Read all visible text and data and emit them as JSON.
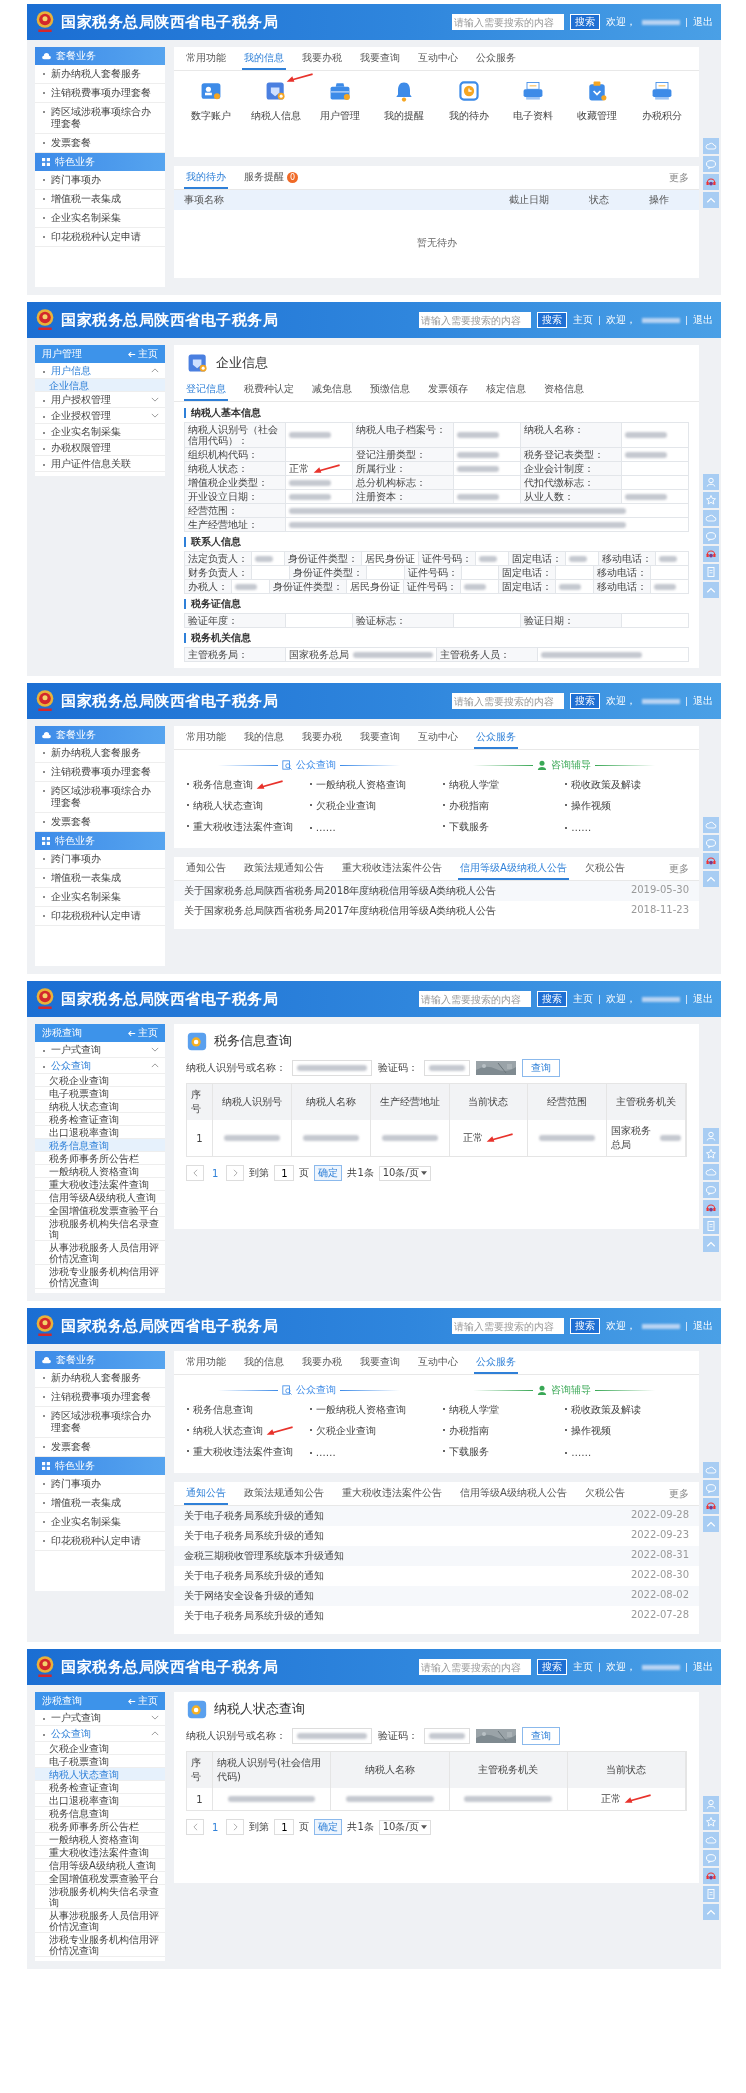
{
  "shots": [
    {
      "header": {
        "title": "国家税务总局陕西省电子税务局",
        "search_placeholder": "请输入需要搜索的内容",
        "search_button": "搜索",
        "welcome": "欢迎，",
        "logout": "退出"
      },
      "sidebar": {
        "kind": "groups",
        "groups": [
          {
            "title": "套餐业务",
            "items": [
              "新办纳税人套餐服务",
              "注销税费事项办理套餐",
              "跨区域涉税事项综合办理套餐",
              "发票套餐"
            ]
          },
          {
            "title": "特色业务",
            "items": [
              "跨门事项办",
              "增值税一表集成",
              "企业实名制采集",
              "印花税税种认定申请"
            ]
          }
        ]
      },
      "main": {
        "kind": "home",
        "tabs": [
          {
            "label": "常用功能",
            "selected": false
          },
          {
            "label": "我的信息",
            "selected": true
          },
          {
            "label": "我要办税",
            "selected": false
          },
          {
            "label": "我要查询",
            "selected": false
          },
          {
            "label": "互动中心",
            "selected": false
          },
          {
            "label": "公众服务",
            "selected": false
          }
        ],
        "apps": [
          {
            "label": "数字账户"
          },
          {
            "label": "纳税人信息",
            "annotated": true
          },
          {
            "label": "用户管理"
          },
          {
            "label": "我的提醒"
          },
          {
            "label": "我的待办"
          },
          {
            "label": "电子资料"
          },
          {
            "label": "收藏管理"
          },
          {
            "label": "办税积分"
          }
        ],
        "todo": {
          "tabs": [
            {
              "label": "我的待办",
              "selected": true
            },
            {
              "label": "服务提醒",
              "selected": false,
              "badge": "0"
            }
          ],
          "more": "更多",
          "columns": [
            "事项名称",
            "截止日期",
            "状态",
            "操作"
          ],
          "empty": "暂无待办"
        }
      },
      "side_tools": [
        {
          "kind": "cloud"
        },
        {
          "kind": "chat"
        },
        {
          "kind": "service"
        },
        {
          "kind": "top"
        }
      ]
    },
    {
      "header": {
        "title": "国家税务总局陕西省电子税务局",
        "search_placeholder": "请输入需要搜索的内容",
        "search_button": "搜索",
        "home_link": "主页",
        "welcome": "欢迎，",
        "logout": "退出"
      },
      "sidebar": {
        "kind": "nav",
        "title": "用户管理",
        "home": "主页",
        "items": [
          {
            "label": "用户信息",
            "selected": true,
            "expanded": true,
            "children": [
              {
                "label": "企业信息",
                "selected": true
              }
            ]
          },
          {
            "label": "用户授权管理",
            "selected": false,
            "expanded": false
          },
          {
            "label": "企业授权管理",
            "selected": false,
            "expanded": false
          },
          {
            "label": "企业实名制采集",
            "selected": false
          },
          {
            "label": "办税权限管理",
            "selected": false
          },
          {
            "label": "用户证件信息关联",
            "selected": false
          }
        ]
      },
      "main": {
        "kind": "company",
        "title": "企业信息",
        "tabs": [
          {
            "label": "登记信息",
            "selected": true
          },
          {
            "label": "税费种认定",
            "selected": false
          },
          {
            "label": "减免信息",
            "selected": false
          },
          {
            "label": "预缴信息",
            "selected": false
          },
          {
            "label": "发票领存",
            "selected": false
          },
          {
            "label": "核定信息",
            "selected": false
          },
          {
            "label": "资格信息",
            "selected": false
          }
        ],
        "sections": [
          {
            "title": "纳税人基本信息",
            "rows": [
              [
                {
                  "label": "纳税人识别号（社会信用代码）：",
                  "blurred": true
                },
                {
                  "label": "纳税人电子档案号：",
                  "blurred": true
                },
                {
                  "label": "纳税人名称：",
                  "blurred": true
                }
              ],
              [
                {
                  "label": "组织机构代码：",
                  "blurred": false
                },
                {
                  "label": "登记注册类型：",
                  "blurred": true
                },
                {
                  "label": "税务登记表类型：",
                  "blurred": true
                }
              ],
              [
                {
                  "label": "纳税人状态：",
                  "value": "正常",
                  "blurred": false,
                  "annotated": true
                },
                {
                  "label": "所属行业：",
                  "blurred": true
                },
                {
                  "label": "企业会计制度：",
                  "blurred": false
                }
              ],
              [
                {
                  "label": "增值税企业类型：",
                  "blurred": true
                },
                {
                  "label": "总分机构标志：",
                  "blurred": false
                },
                {
                  "label": "代扣代缴标志：",
                  "blurred": false
                }
              ],
              [
                {
                  "label": "开业设立日期：",
                  "blurred": true
                },
                {
                  "label": "注册资本：",
                  "blurred": true
                },
                {
                  "label": "从业人数：",
                  "blurred": true
                }
              ],
              [
                {
                  "label": "经营范围：",
                  "blurred": true
                }
              ],
              [
                {
                  "label": "生产经营地址：",
                  "blurred": true
                }
              ]
            ]
          },
          {
            "title": "联系人信息",
            "rows": [
              [
                {
                  "label": "法定负责人：",
                  "blurred": true
                },
                {
                  "label": "身份证件类型：",
                  "value": "居民身份证",
                  "blurred": false
                },
                {
                  "label": "证件号码：",
                  "blurred": true
                },
                {
                  "label": "固定电话：",
                  "blurred": true
                },
                {
                  "label": "移动电话：",
                  "blurred": true
                }
              ],
              [
                {
                  "label": "财务负责人：",
                  "blurred": false
                },
                {
                  "label": "身份证件类型：",
                  "blurred": false
                },
                {
                  "label": "证件号码：",
                  "blurred": false
                },
                {
                  "label": "固定电话：",
                  "blurred": false
                },
                {
                  "label": "移动电话：",
                  "blurred": false
                }
              ],
              [
                {
                  "label": "办税人：",
                  "blurred": true
                },
                {
                  "label": "身份证件类型：",
                  "value": "居民身份证",
                  "blurred": false
                },
                {
                  "label": "证件号码：",
                  "blurred": true
                },
                {
                  "label": "固定电话：",
                  "blurred": true
                },
                {
                  "label": "移动电话：",
                  "blurred": true
                }
              ]
            ]
          },
          {
            "title": "税务证信息",
            "rows": [
              [
                {
                  "label": "验证年度：",
                  "blurred": false
                },
                {
                  "label": "验证标志：",
                  "blurred": false
                },
                {
                  "label": "验证日期：",
                  "blurred": false
                }
              ]
            ]
          },
          {
            "title": "税务机关信息",
            "rows": [
              [
                {
                  "label": "主管税务局：",
                  "value": "国家税务总局",
                  "blurred": true
                },
                {
                  "label": "主管税务人员：",
                  "blurred": true
                }
              ]
            ]
          }
        ]
      },
      "side_tools": [
        {
          "kind": "person"
        },
        {
          "kind": "star"
        },
        {
          "kind": "cloud"
        },
        {
          "kind": "chat"
        },
        {
          "kind": "service"
        },
        {
          "kind": "note"
        },
        {
          "kind": "top"
        }
      ]
    },
    {
      "header": {
        "title": "国家税务总局陕西省电子税务局",
        "search_placeholder": "请输入需要搜索的内容",
        "search_button": "搜索",
        "welcome": "欢迎，",
        "logout": "退出"
      },
      "sidebar": {
        "kind": "groups",
        "groups": [
          {
            "title": "套餐业务",
            "items": [
              "新办纳税人套餐服务",
              "注销税费事项办理套餐",
              "跨区域涉税事项综合办理套餐",
              "发票套餐"
            ]
          },
          {
            "title": "特色业务",
            "items": [
              "跨门事项办",
              "增值税一表集成",
              "企业实名制采集",
              "印花税税种认定申请"
            ]
          }
        ]
      },
      "main": {
        "kind": "public",
        "tabs": [
          {
            "label": "常用功能",
            "selected": false
          },
          {
            "label": "我的信息",
            "selected": false
          },
          {
            "label": "我要办税",
            "selected": false
          },
          {
            "label": "我要查询",
            "selected": false
          },
          {
            "label": "互动中心",
            "selected": false
          },
          {
            "label": "公众服务",
            "selected": true
          }
        ],
        "sections": [
          {
            "title": "公众查询",
            "links": [
              {
                "label": "税务信息查询",
                "annotated": true
              },
              {
                "label": "一般纳税人资格查询"
              },
              {
                "label": "纳税人状态查询"
              },
              {
                "label": "欠税企业查询"
              },
              {
                "label": "重大税收违法案件查询"
              },
              {
                "label": "……"
              }
            ]
          },
          {
            "title": "咨询辅导",
            "links": [
              {
                "label": "纳税人学堂"
              },
              {
                "label": "税收政策及解读"
              },
              {
                "label": "办税指南"
              },
              {
                "label": "操作视频"
              },
              {
                "label": "下载服务"
              },
              {
                "label": "……"
              }
            ]
          }
        ],
        "notices": {
          "tabs": [
            {
              "label": "通知公告",
              "selected": false
            },
            {
              "label": "政策法规通知公告",
              "selected": false
            },
            {
              "label": "重大税收违法案件公告",
              "selected": false
            },
            {
              "label": "信用等级A级纳税人公告",
              "selected": true
            },
            {
              "label": "欠税公告",
              "selected": false
            }
          ],
          "more": "更多",
          "rows": [
            {
              "title": "关于国家税务总局陕西省税务局2018年度纳税信用等级A类纳税人公告",
              "date": "2019-05-30"
            },
            {
              "title": "关于国家税务总局陕西省税务局2017年度纳税信用等级A类纳税人公告",
              "date": "2018-11-23"
            }
          ]
        }
      },
      "side_tools": [
        {
          "kind": "cloud"
        },
        {
          "kind": "chat"
        },
        {
          "kind": "service"
        },
        {
          "kind": "top"
        }
      ]
    },
    {
      "header": {
        "title": "国家税务总局陕西省电子税务局",
        "search_placeholder": "请输入需要搜索的内容",
        "search_button": "搜索",
        "home_link": "主页",
        "welcome": "欢迎，",
        "logout": "退出"
      },
      "sidebar": {
        "kind": "nav",
        "title": "涉税查询",
        "home": "主页",
        "items": [
          {
            "label": "一户式查询",
            "selected": false,
            "expanded": false
          },
          {
            "label": "公众查询",
            "selected": true,
            "expanded": true,
            "children": [
              {
                "label": "欠税企业查询",
                "selected": false
              },
              {
                "label": "电子税票查询",
                "selected": false
              },
              {
                "label": "纳税人状态查询",
                "selected": false
              },
              {
                "label": "税务检查证查询",
                "selected": false
              },
              {
                "label": "出口退税率查询",
                "selected": false
              },
              {
                "label": "税务信息查询",
                "selected": true
              },
              {
                "label": "税务师事务所公告栏",
                "selected": false
              },
              {
                "label": "一般纳税人资格查询",
                "selected": false
              },
              {
                "label": "重大税收违法案件查询",
                "selected": false
              },
              {
                "label": "信用等级A级纳税人查询",
                "selected": false
              },
              {
                "label": "全国增值税发票查验平台",
                "selected": false
              },
              {
                "label": "涉税服务机构失信名录查询",
                "selected": false
              },
              {
                "label": "从事涉税服务人员信用评价情况查询",
                "selected": false
              },
              {
                "label": "涉税专业服务机构信用评价情况查询",
                "selected": false
              }
            ]
          }
        ]
      },
      "main": {
        "kind": "query",
        "title": "税务信息查询",
        "form": {
          "label": "纳税人识别号或名称：",
          "captcha_label": "验证码：",
          "button": "查询"
        },
        "table": {
          "columns": [
            "序号",
            "纳税人识别号",
            "纳税人名称",
            "生产经营地址",
            "当前状态",
            "经营范围",
            "主管税务机关"
          ],
          "rows": [
            [
              {
                "value": "1",
                "blurred": false
              },
              {
                "blurred": true
              },
              {
                "blurred": true
              },
              {
                "blurred": true
              },
              {
                "value": "正常",
                "blurred": false,
                "annotated": true
              },
              {
                "blurred": true
              },
              {
                "value": "国家税务总局",
                "blurred": true
              }
            ]
          ]
        },
        "pagination": {
          "current": "1",
          "goto": "到第",
          "page_input": "1",
          "page_unit": "页",
          "confirm": "确定",
          "total": "共1条",
          "size": "10条/页"
        }
      },
      "side_tools": [
        {
          "kind": "person"
        },
        {
          "kind": "star"
        },
        {
          "kind": "cloud"
        },
        {
          "kind": "chat"
        },
        {
          "kind": "service"
        },
        {
          "kind": "note"
        },
        {
          "kind": "top"
        }
      ]
    },
    {
      "header": {
        "title": "国家税务总局陕西省电子税务局",
        "search_placeholder": "请输入需要搜索的内容",
        "search_button": "搜索",
        "welcome": "欢迎，",
        "logout": "退出"
      },
      "sidebar": {
        "kind": "groups",
        "groups": [
          {
            "title": "套餐业务",
            "items": [
              "新办纳税人套餐服务",
              "注销税费事项办理套餐",
              "跨区域涉税事项综合办理套餐",
              "发票套餐"
            ]
          },
          {
            "title": "特色业务",
            "items": [
              "跨门事项办",
              "增值税一表集成",
              "企业实名制采集",
              "印花税税种认定申请"
            ]
          }
        ]
      },
      "main": {
        "kind": "public",
        "tabs": [
          {
            "label": "常用功能",
            "selected": false
          },
          {
            "label": "我的信息",
            "selected": false
          },
          {
            "label": "我要办税",
            "selected": false
          },
          {
            "label": "我要查询",
            "selected": false
          },
          {
            "label": "互动中心",
            "selected": false
          },
          {
            "label": "公众服务",
            "selected": true
          }
        ],
        "sections": [
          {
            "title": "公众查询",
            "links": [
              {
                "label": "税务信息查询"
              },
              {
                "label": "一般纳税人资格查询"
              },
              {
                "label": "纳税人状态查询",
                "annotated": true
              },
              {
                "label": "欠税企业查询"
              },
              {
                "label": "重大税收违法案件查询"
              },
              {
                "label": "……"
              }
            ]
          },
          {
            "title": "咨询辅导",
            "links": [
              {
                "label": "纳税人学堂"
              },
              {
                "label": "税收政策及解读"
              },
              {
                "label": "办税指南"
              },
              {
                "label": "操作视频"
              },
              {
                "label": "下载服务"
              },
              {
                "label": "……"
              }
            ]
          }
        ],
        "notices": {
          "tabs": [
            {
              "label": "通知公告",
              "selected": true
            },
            {
              "label": "政策法规通知公告",
              "selected": false
            },
            {
              "label": "重大税收违法案件公告",
              "selected": false
            },
            {
              "label": "信用等级A级纳税人公告",
              "selected": false
            },
            {
              "label": "欠税公告",
              "selected": false
            }
          ],
          "more": "更多",
          "rows": [
            {
              "title": "关于电子税务局系统升级的通知",
              "date": "2022-09-28"
            },
            {
              "title": "关于电子税务局系统升级的通知",
              "date": "2022-09-23"
            },
            {
              "title": "金税三期税收管理系统版本升级通知",
              "date": "2022-08-31"
            },
            {
              "title": "关于电子税务局系统升级的通知",
              "date": "2022-08-30"
            },
            {
              "title": "关于网络安全设备升级的通知",
              "date": "2022-08-02"
            },
            {
              "title": "关于电子税务局系统升级的通知",
              "date": "2022-07-28"
            }
          ]
        }
      },
      "side_tools": [
        {
          "kind": "cloud"
        },
        {
          "kind": "chat"
        },
        {
          "kind": "service"
        },
        {
          "kind": "top"
        }
      ]
    },
    {
      "header": {
        "title": "国家税务总局陕西省电子税务局",
        "search_placeholder": "请输入需要搜索的内容",
        "search_button": "搜索",
        "home_link": "主页",
        "welcome": "欢迎，",
        "logout": "退出"
      },
      "sidebar": {
        "kind": "nav",
        "title": "涉税查询",
        "home": "主页",
        "items": [
          {
            "label": "一户式查询",
            "selected": false,
            "expanded": false
          },
          {
            "label": "公众查询",
            "selected": true,
            "expanded": true,
            "children": [
              {
                "label": "欠税企业查询",
                "selected": false
              },
              {
                "label": "电子税票查询",
                "selected": false
              },
              {
                "label": "纳税人状态查询",
                "selected": true
              },
              {
                "label": "税务检查证查询",
                "selected": false
              },
              {
                "label": "出口退税率查询",
                "selected": false
              },
              {
                "label": "税务信息查询",
                "selected": false
              },
              {
                "label": "税务师事务所公告栏",
                "selected": false
              },
              {
                "label": "一般纳税人资格查询",
                "selected": false
              },
              {
                "label": "重大税收违法案件查询",
                "selected": false
              },
              {
                "label": "信用等级A级纳税人查询",
                "selected": false
              },
              {
                "label": "全国增值税发票查验平台",
                "selected": false
              },
              {
                "label": "涉税服务机构失信名录查询",
                "selected": false
              },
              {
                "label": "从事涉税服务人员信用评价情况查询",
                "selected": false
              },
              {
                "label": "涉税专业服务机构信用评价情况查询",
                "selected": false
              }
            ]
          }
        ]
      },
      "main": {
        "kind": "query",
        "title": "纳税人状态查询",
        "form": {
          "label": "纳税人识别号或名称：",
          "captcha_label": "验证码：",
          "button": "查询"
        },
        "table": {
          "columns": [
            "序号",
            "纳税人识别号(社会信用代码)",
            "纳税人名称",
            "主管税务机关",
            "当前状态"
          ],
          "rows": [
            [
              {
                "value": "1",
                "blurred": false
              },
              {
                "blurred": true
              },
              {
                "blurred": true
              },
              {
                "blurred": true
              },
              {
                "value": "正常",
                "blurred": false,
                "annotated": true
              }
            ]
          ]
        },
        "pagination": {
          "current": "1",
          "goto": "到第",
          "page_input": "1",
          "page_unit": "页",
          "confirm": "确定",
          "total": "共1条",
          "size": "10条/页"
        }
      },
      "side_tools": [
        {
          "kind": "person"
        },
        {
          "kind": "star"
        },
        {
          "kind": "cloud"
        },
        {
          "kind": "chat"
        },
        {
          "kind": "service"
        },
        {
          "kind": "note"
        },
        {
          "kind": "top"
        }
      ]
    }
  ]
}
